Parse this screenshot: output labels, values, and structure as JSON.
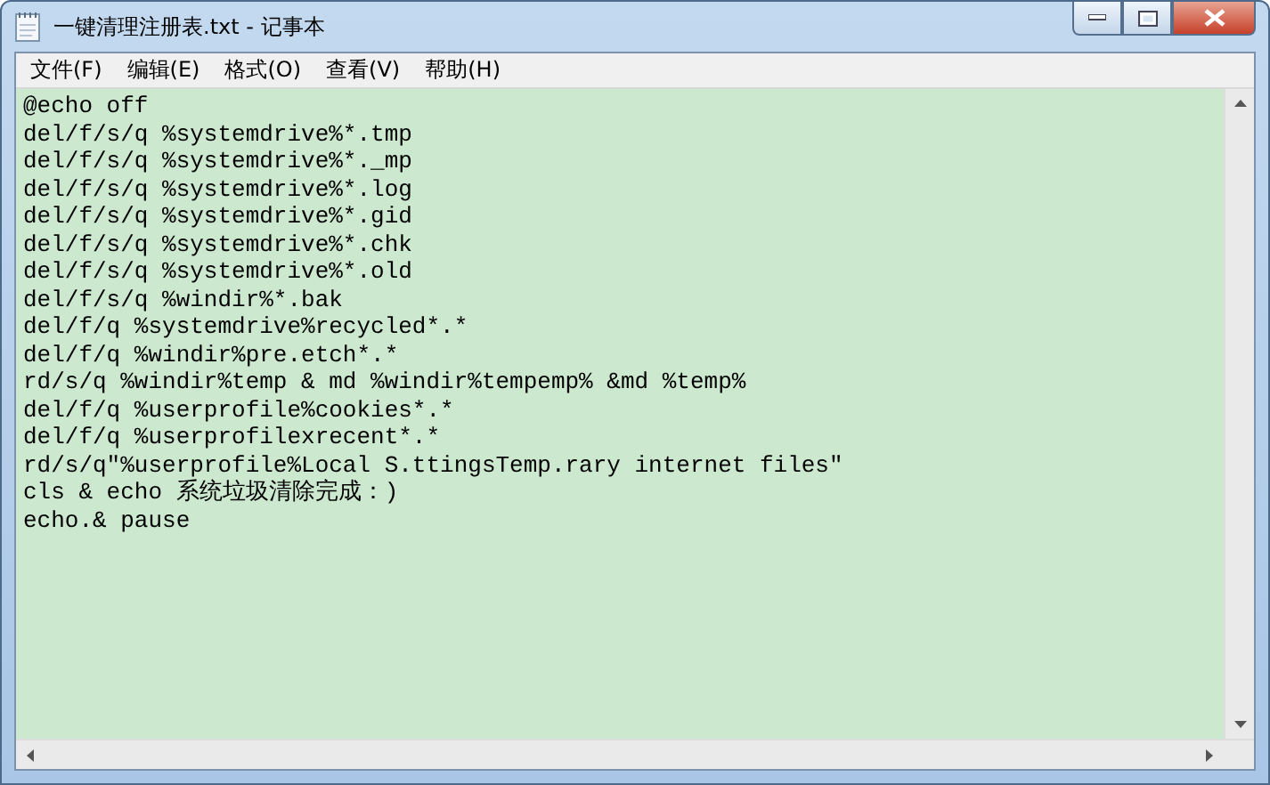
{
  "window": {
    "title": "一键清理注册表.txt - 记事本"
  },
  "menu": [
    "文件(F)",
    "编辑(E)",
    "格式(O)",
    "查看(V)",
    "帮助(H)"
  ],
  "editor": {
    "lines": [
      "@echo off",
      "del/f/s/q %systemdrive%*.tmp",
      "del/f/s/q %systemdrive%*._mp",
      "del/f/s/q %systemdrive%*.log",
      "del/f/s/q %systemdrive%*.gid",
      "del/f/s/q %systemdrive%*.chk",
      "del/f/s/q %systemdrive%*.old",
      "del/f/s/q %windir%*.bak",
      "del/f/q %systemdrive%recycled*.*",
      "del/f/q %windir%pre.etch*.*",
      "rd/s/q %windir%temp & md %windir%tempemp% &md %temp%",
      "del/f/q %userprofile%cookies*.*",
      "del/f/q %userprofilexrecent*.*",
      "rd/s/q\"%userprofile%Local S.ttingsTemp.rary internet files\"",
      "cls & echo 系统垃圾清除完成：)",
      "echo.& pause"
    ]
  }
}
